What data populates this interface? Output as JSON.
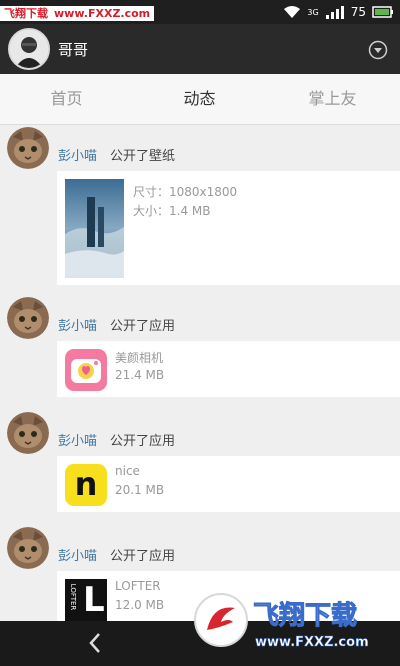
{
  "watermark_top": {
    "text": "飞翔下载",
    "url": "www.FXXZ.com"
  },
  "status_bar": {
    "signal_label": "3G",
    "battery": "75"
  },
  "header": {
    "title": "哥哥"
  },
  "tabs": [
    {
      "label": "首页"
    },
    {
      "label": "动态"
    },
    {
      "label": "掌上友"
    }
  ],
  "posts": [
    {
      "user": "彭小喵",
      "action": "公开了壁纸",
      "line1": "尺寸：1080x1800",
      "line2": "大小：1.4 MB"
    },
    {
      "user": "彭小喵",
      "action": "公开了应用",
      "line1": "美颜相机",
      "line2": "21.4 MB"
    },
    {
      "user": "彭小喵",
      "action": "公开了应用",
      "line1": "nice",
      "line2": "20.1 MB"
    },
    {
      "user": "彭小喵",
      "action": "公开了应用",
      "line1": "LOFTER",
      "line2": "12.0 MB"
    }
  ],
  "icons": {
    "nice_letter": "n",
    "lofter_letter": "L",
    "lofter_vertical": "LOFTER"
  },
  "watermark_bottom": {
    "title": "飞翔下载",
    "url": "www.FXXZ.com"
  },
  "colors": {
    "username": "#3f78a6",
    "tab_active": "#333333",
    "tab_inactive": "#999999"
  }
}
